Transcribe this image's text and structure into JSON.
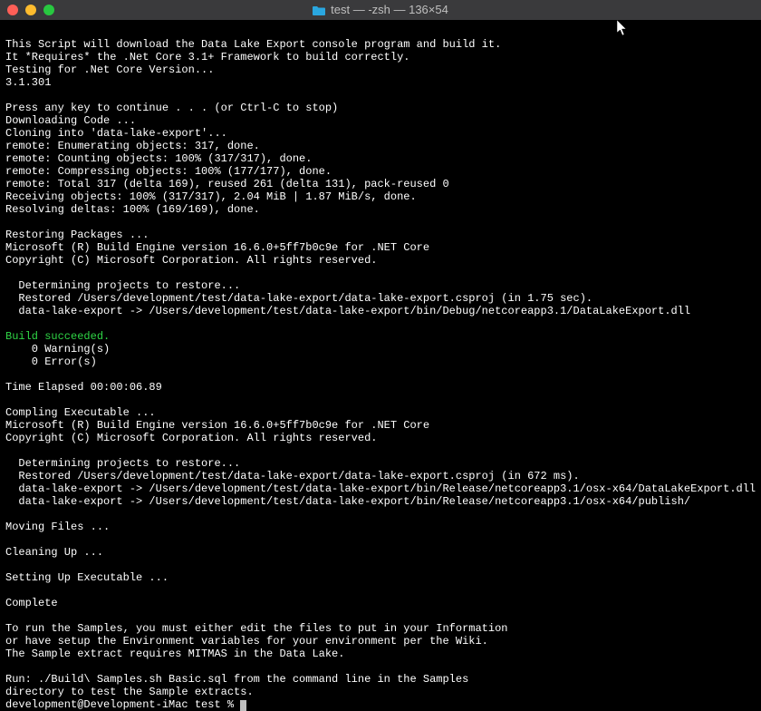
{
  "titlebar": {
    "title": "test — -zsh — 136×54"
  },
  "lines": [
    {
      "t": ""
    },
    {
      "t": "This Script will download the Data Lake Export console program and build it."
    },
    {
      "t": "It *Requires* the .Net Core 3.1+ Framework to build correctly."
    },
    {
      "t": "Testing for .Net Core Version..."
    },
    {
      "t": "3.1.301"
    },
    {
      "t": ""
    },
    {
      "t": "Press any key to continue . . . (or Ctrl-C to stop)"
    },
    {
      "t": "Downloading Code ..."
    },
    {
      "t": "Cloning into 'data-lake-export'..."
    },
    {
      "t": "remote: Enumerating objects: 317, done."
    },
    {
      "t": "remote: Counting objects: 100% (317/317), done."
    },
    {
      "t": "remote: Compressing objects: 100% (177/177), done."
    },
    {
      "t": "remote: Total 317 (delta 169), reused 261 (delta 131), pack-reused 0"
    },
    {
      "t": "Receiving objects: 100% (317/317), 2.04 MiB | 1.87 MiB/s, done."
    },
    {
      "t": "Resolving deltas: 100% (169/169), done."
    },
    {
      "t": ""
    },
    {
      "t": "Restoring Packages ..."
    },
    {
      "t": "Microsoft (R) Build Engine version 16.6.0+5ff7b0c9e for .NET Core"
    },
    {
      "t": "Copyright (C) Microsoft Corporation. All rights reserved."
    },
    {
      "t": ""
    },
    {
      "t": "  Determining projects to restore..."
    },
    {
      "t": "  Restored /Users/development/test/data-lake-export/data-lake-export.csproj (in 1.75 sec)."
    },
    {
      "t": "  data-lake-export -> /Users/development/test/data-lake-export/bin/Debug/netcoreapp3.1/DataLakeExport.dll"
    },
    {
      "t": ""
    },
    {
      "t": "Build succeeded.",
      "cls": "green"
    },
    {
      "t": "    0 Warning(s)"
    },
    {
      "t": "    0 Error(s)"
    },
    {
      "t": ""
    },
    {
      "t": "Time Elapsed 00:00:06.89"
    },
    {
      "t": ""
    },
    {
      "t": "Compling Executable ..."
    },
    {
      "t": "Microsoft (R) Build Engine version 16.6.0+5ff7b0c9e for .NET Core"
    },
    {
      "t": "Copyright (C) Microsoft Corporation. All rights reserved."
    },
    {
      "t": ""
    },
    {
      "t": "  Determining projects to restore..."
    },
    {
      "t": "  Restored /Users/development/test/data-lake-export/data-lake-export.csproj (in 672 ms)."
    },
    {
      "t": "  data-lake-export -> /Users/development/test/data-lake-export/bin/Release/netcoreapp3.1/osx-x64/DataLakeExport.dll"
    },
    {
      "t": "  data-lake-export -> /Users/development/test/data-lake-export/bin/Release/netcoreapp3.1/osx-x64/publish/"
    },
    {
      "t": ""
    },
    {
      "t": "Moving Files ..."
    },
    {
      "t": ""
    },
    {
      "t": "Cleaning Up ..."
    },
    {
      "t": ""
    },
    {
      "t": "Setting Up Executable ..."
    },
    {
      "t": ""
    },
    {
      "t": "Complete"
    },
    {
      "t": ""
    },
    {
      "t": "To run the Samples, you must either edit the files to put in your Information"
    },
    {
      "t": "or have setup the Environment variables for your environment per the Wiki."
    },
    {
      "t": "The Sample extract requires MITMAS in the Data Lake."
    },
    {
      "t": ""
    },
    {
      "t": "Run: ./Build\\ Samples.sh Basic.sql from the command line in the Samples"
    },
    {
      "t": "directory to test the Sample extracts."
    }
  ],
  "prompt": "development@Development-iMac test % "
}
